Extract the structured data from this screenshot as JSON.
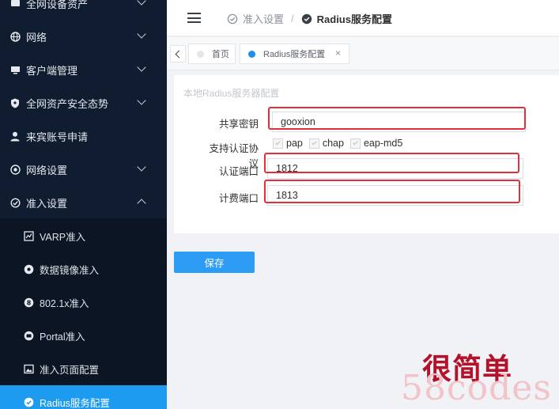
{
  "sidebar": {
    "items": [
      {
        "label": "全网设备资产",
        "icon": "devices-icon",
        "expanded": false
      },
      {
        "label": "网络",
        "icon": "globe-icon",
        "expanded": false
      },
      {
        "label": "客户端管理",
        "icon": "monitor-icon",
        "expanded": false
      },
      {
        "label": "全网资产安全态势",
        "icon": "shield-icon",
        "expanded": false
      },
      {
        "label": "来宾账号申请",
        "icon": "user-icon",
        "expanded": null
      },
      {
        "label": "网络设置",
        "icon": "network-gear-icon",
        "expanded": false
      },
      {
        "label": "准入设置",
        "icon": "access-shield-icon",
        "expanded": true
      }
    ],
    "subitems": [
      {
        "label": "VARP准入",
        "icon": "chart-icon"
      },
      {
        "label": "数据镜像准入",
        "icon": "mirror-icon"
      },
      {
        "label": "802.1x准入",
        "icon": "number-8-icon"
      },
      {
        "label": "Portal准入",
        "icon": "portal-icon"
      },
      {
        "label": "准入页面配置",
        "icon": "image-icon"
      },
      {
        "label": "Radius服务配置",
        "icon": "check-circle-icon",
        "active": true
      }
    ]
  },
  "header": {
    "breadcrumb": [
      "准入设置",
      "Radius服务配置"
    ],
    "separator": "/"
  },
  "tabs": [
    {
      "label": "首页",
      "active": false
    },
    {
      "label": "Radius服务配置",
      "active": true,
      "close": "×"
    }
  ],
  "form": {
    "title": "本地Radius服务器配置",
    "secret_label": "共享密钥",
    "secret_value": "gooxion",
    "protocol_label": "支持认证协议",
    "protocols": [
      "pap",
      "chap",
      "eap-md5"
    ],
    "auth_port_label": "认证端口",
    "auth_port_value": "1812",
    "acct_port_label": "计费端口",
    "acct_port_value": "1813",
    "save_label": "保存"
  },
  "watermark": {
    "cn": "很简单",
    "en": "58codes"
  },
  "colors": {
    "sidebar_bg": "#101d30",
    "active_blue": "#1d9bf0",
    "highlight_red": "#e0303a",
    "button_blue": "#2d9cf4"
  }
}
